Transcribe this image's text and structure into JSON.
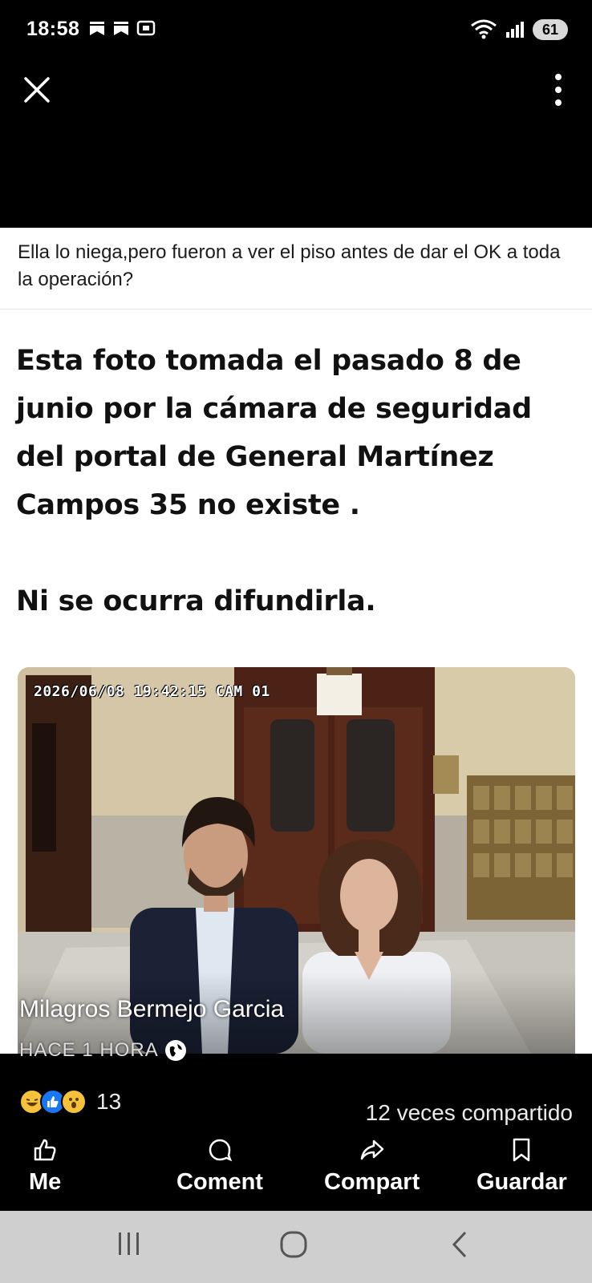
{
  "status": {
    "time": "18:58",
    "battery": "61",
    "left_icons": [
      "notification-icon",
      "notification-icon",
      "screenshot-icon"
    ],
    "right_icons": [
      "wifi-icon",
      "signal-icon",
      "battery-icon"
    ]
  },
  "nav": {
    "close_icon": "close-icon",
    "more_icon": "more-vertical-icon"
  },
  "post": {
    "caption": "Ella lo niega,pero fueron a ver el piso antes de dar el OK a toda la operación?",
    "headline_lines": [
      "Esta foto tomada el pasado 8 de",
      "junio por la cámara de seguridad",
      "del portal de General  Martínez",
      "Campos 35  no existe ."
    ],
    "headline_footer": "Ni se ocurra difundirla.",
    "cam_stamp": "2026/06/08 19:42:15  CAM 01",
    "author": "Milagros Bermejo Garcia",
    "time_ago": "HACE 1 HORA",
    "reaction_count": "13",
    "shares": "12 veces compartido"
  },
  "actions": {
    "like": "Me",
    "comment": "Coment",
    "share": "Compart",
    "save": "Guardar"
  },
  "colors": {
    "background": "#000000",
    "caption_bg": "#ffffff",
    "like_blue": "#1877f2",
    "system_nav": "#cfcfcf"
  }
}
